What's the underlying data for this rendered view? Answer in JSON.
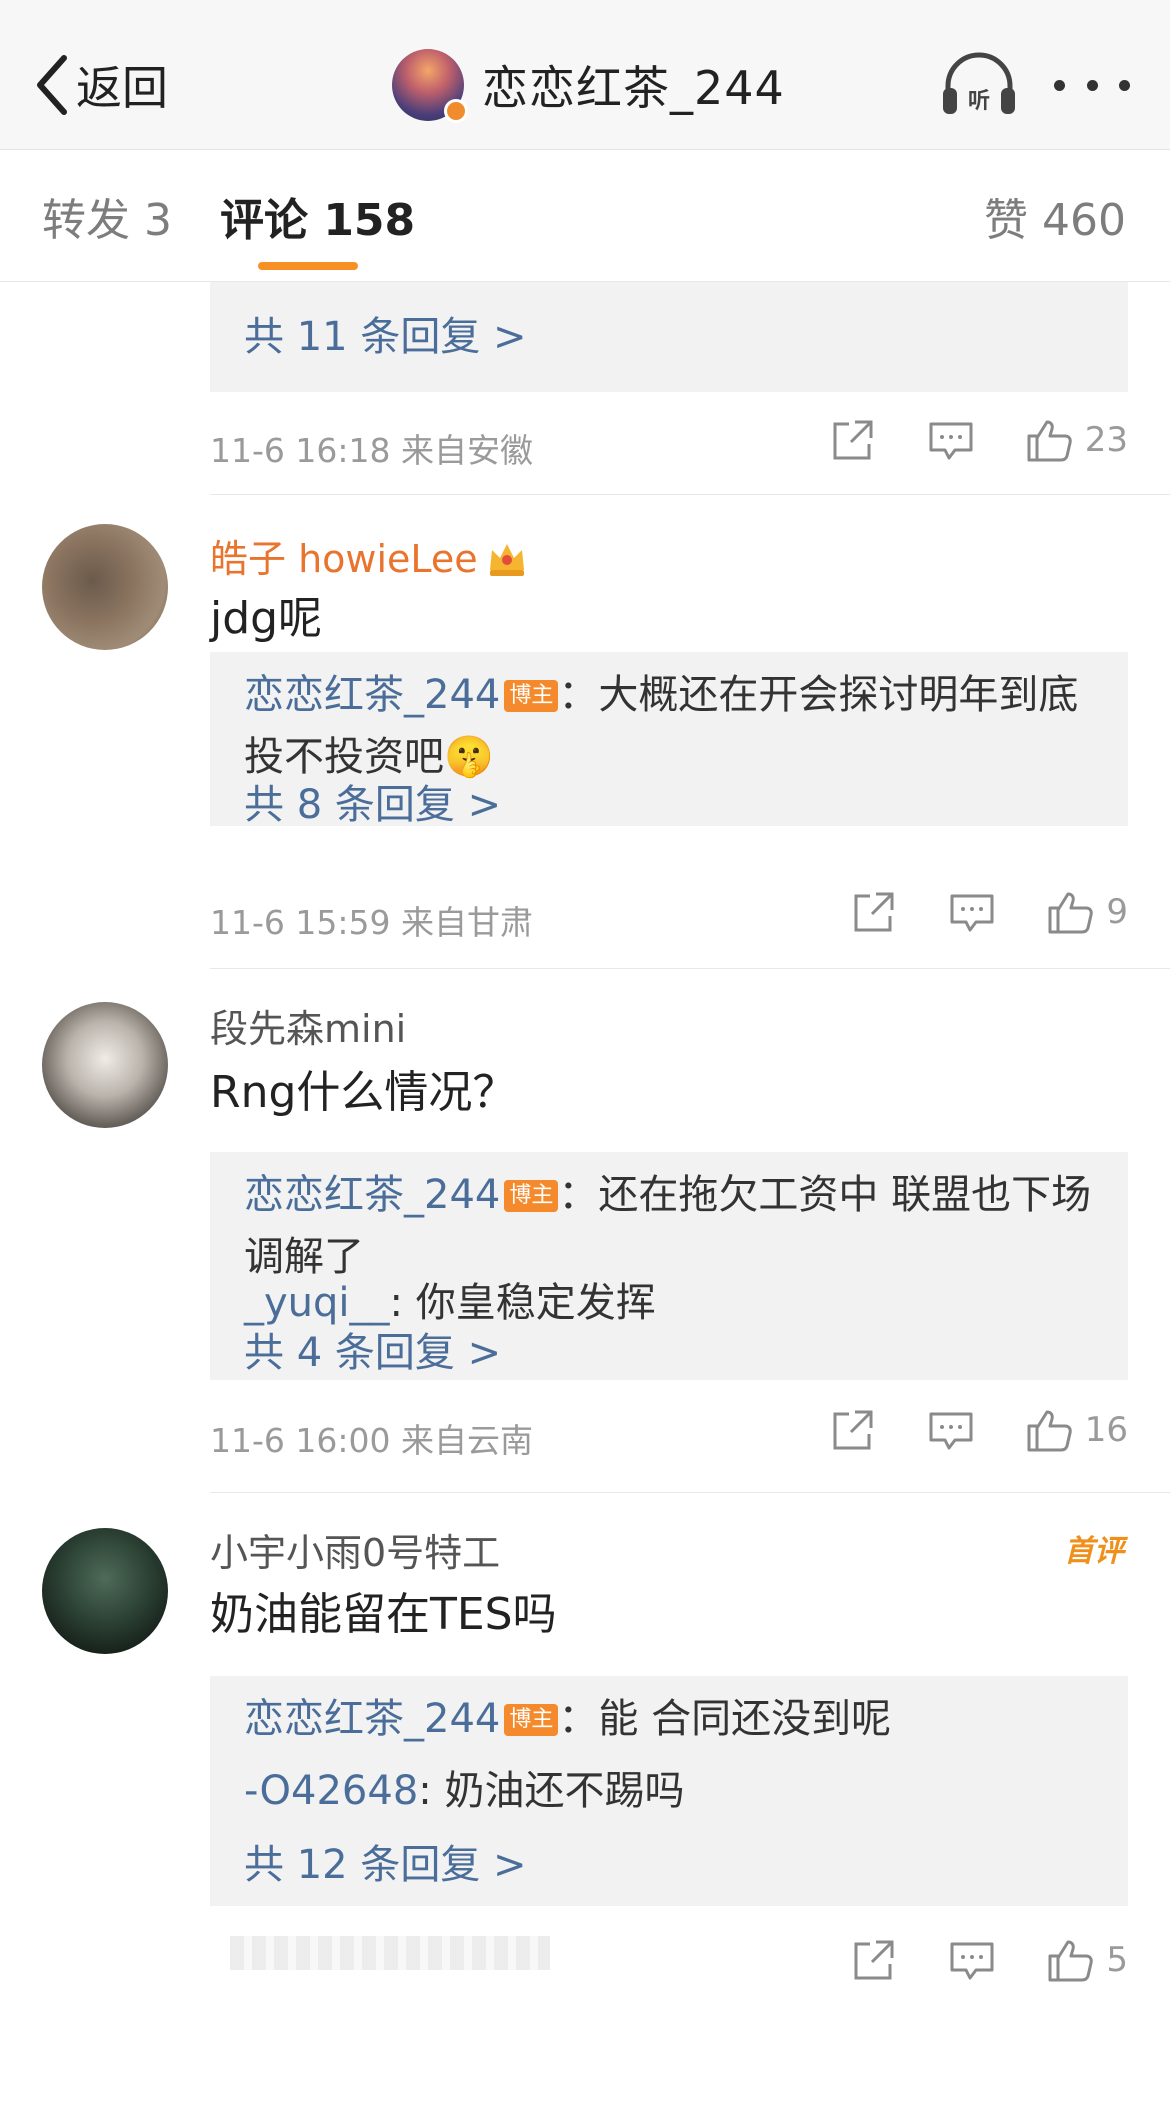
{
  "header": {
    "back_label": "返回",
    "title": "恋恋红茶_244"
  },
  "tabs": {
    "repost": "转发 3",
    "comment": "评论 158",
    "like": "赞 460"
  },
  "colors": {
    "accent": "#f79125",
    "link": "#4a6d9a",
    "orange_name": "#e8742e"
  },
  "comments": [
    {
      "more_replies": "共 11 条回复 >",
      "time_location": "11-6 16:18  来自安徽",
      "likes": "23"
    },
    {
      "username": "皓子 howieLee",
      "text": "jdg呢",
      "replies": [
        {
          "name": "恋恋红茶_244",
          "badge": "博主",
          "text": "：大概还在开会探讨明年到底投不投资吧🤫"
        }
      ],
      "more_replies": "共 8 条回复 >",
      "time_location": "11-6 15:59  来自甘肃",
      "likes": "9"
    },
    {
      "username": "段先森mini",
      "text": "Rng什么情况？",
      "replies": [
        {
          "name": "恋恋红茶_244",
          "badge": "博主",
          "text": "：还在拖欠工资中 联盟也下场调解了"
        },
        {
          "name": "_yuqi__",
          "text": ": 你皇稳定发挥"
        }
      ],
      "more_replies": "共 4 条回复 >",
      "time_location": "11-6 16:00  来自云南",
      "likes": "16"
    },
    {
      "username": "小宇小雨0号特工",
      "tag": "首评",
      "text": "奶油能留在TES吗",
      "replies": [
        {
          "name": "恋恋红茶_244",
          "badge": "博主",
          "text": "：能 合同还没到呢"
        },
        {
          "name": "-O42648",
          "text": ": 奶油还不踢吗"
        }
      ],
      "more_replies": "共 12 条回复 >",
      "likes": "5"
    }
  ]
}
